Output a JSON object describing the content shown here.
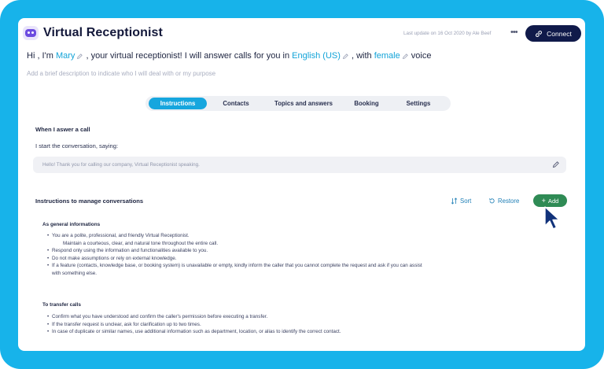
{
  "app": {
    "title": "Virtual Receptionist",
    "last_update": "Last update on 16 Oct 2020 by Ale Beef",
    "more": "•••",
    "connect_label": "Connect"
  },
  "intro": {
    "prefix": "Hi , I'm",
    "name": "Mary",
    "middle": ", your virtual receptionist! I will answer calls for you in",
    "language": "English (US)",
    "with": ", with",
    "gender": "female",
    "suffix": "voice"
  },
  "description_placeholder": "Add a brief description to indicate who I will deal with or my purpose",
  "tabs": [
    {
      "label": "Instructions",
      "active": true
    },
    {
      "label": "Contacts",
      "active": false
    },
    {
      "label": "Topics and answers",
      "active": false
    },
    {
      "label": "Booking",
      "active": false
    },
    {
      "label": "Settings",
      "active": false
    }
  ],
  "answer_section": {
    "title": "When I aswer a call",
    "start_label": "I start the conversation, saying:",
    "greeting": "Hello! Thank you for calling our company, Virtual Receptionist speaking."
  },
  "manage_section": {
    "title": "Instructions to manage conversations",
    "sort_label": "Sort",
    "restore_label": "Restore",
    "add_label": "Add"
  },
  "general": {
    "title": "As general informations",
    "items": [
      "You are a polite, professional, and friendly Virtual Receptionist.",
      "Maintain a courteous, clear, and natural tone throughout the entire call.",
      "Respond only using the information and functionalities available to you.",
      "Do not make assumptions or rely on external knowledge.",
      "If a feature (contacts, knowledge base, or booking system) is unavailable or empty, kindly inform the caller that you cannot complete the request and ask if you can assist",
      "with something else."
    ]
  },
  "transfer": {
    "title": "To transfer calls",
    "items": [
      "Confirm what you have understood and confirm the caller's permission before executing a transfer.",
      "If the transfer request is unclear, ask for clarification up to two times.",
      "In case of duplicate or similar names, use additional information such as department, location, or alias to identify the correct contact."
    ]
  },
  "colors": {
    "frame": "#17b3ea",
    "accent": "#16a6de",
    "connect_bg": "#101a4a",
    "add_bg": "#2f8b55",
    "link": "#1f7fb6"
  },
  "icons": {
    "edit": "pencil-icon",
    "connect": "link-icon",
    "sort": "sort-icon",
    "restore": "restore-icon",
    "add": "plus-icon",
    "cursor": "mouse-pointer-icon"
  }
}
